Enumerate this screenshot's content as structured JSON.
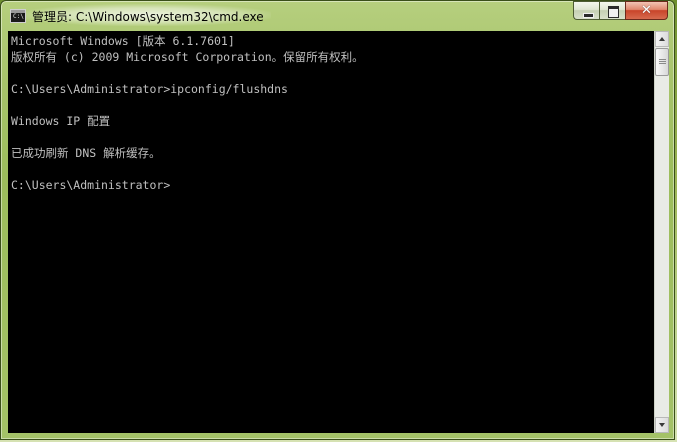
{
  "window": {
    "title": "管理员: C:\\Windows\\system32\\cmd.exe",
    "icon": "cmd-icon",
    "icon_text": "C:\\"
  },
  "caption_buttons": {
    "minimize_icon": "minimize-icon",
    "maximize_icon": "maximize-icon",
    "close_glyph": "✕"
  },
  "console": {
    "lines": [
      "Microsoft Windows [版本 6.1.7601]",
      "版权所有 (c) 2009 Microsoft Corporation。保留所有权利。",
      "",
      "C:\\Users\\Administrator>ipconfig/flushdns",
      "",
      "Windows IP 配置",
      "",
      "已成功刷新 DNS 解析缓存。",
      "",
      "C:\\Users\\Administrator>"
    ]
  },
  "colors": {
    "console_background": "#000000",
    "console_text": "#c0c0c0",
    "close_button": "#c8442a"
  }
}
